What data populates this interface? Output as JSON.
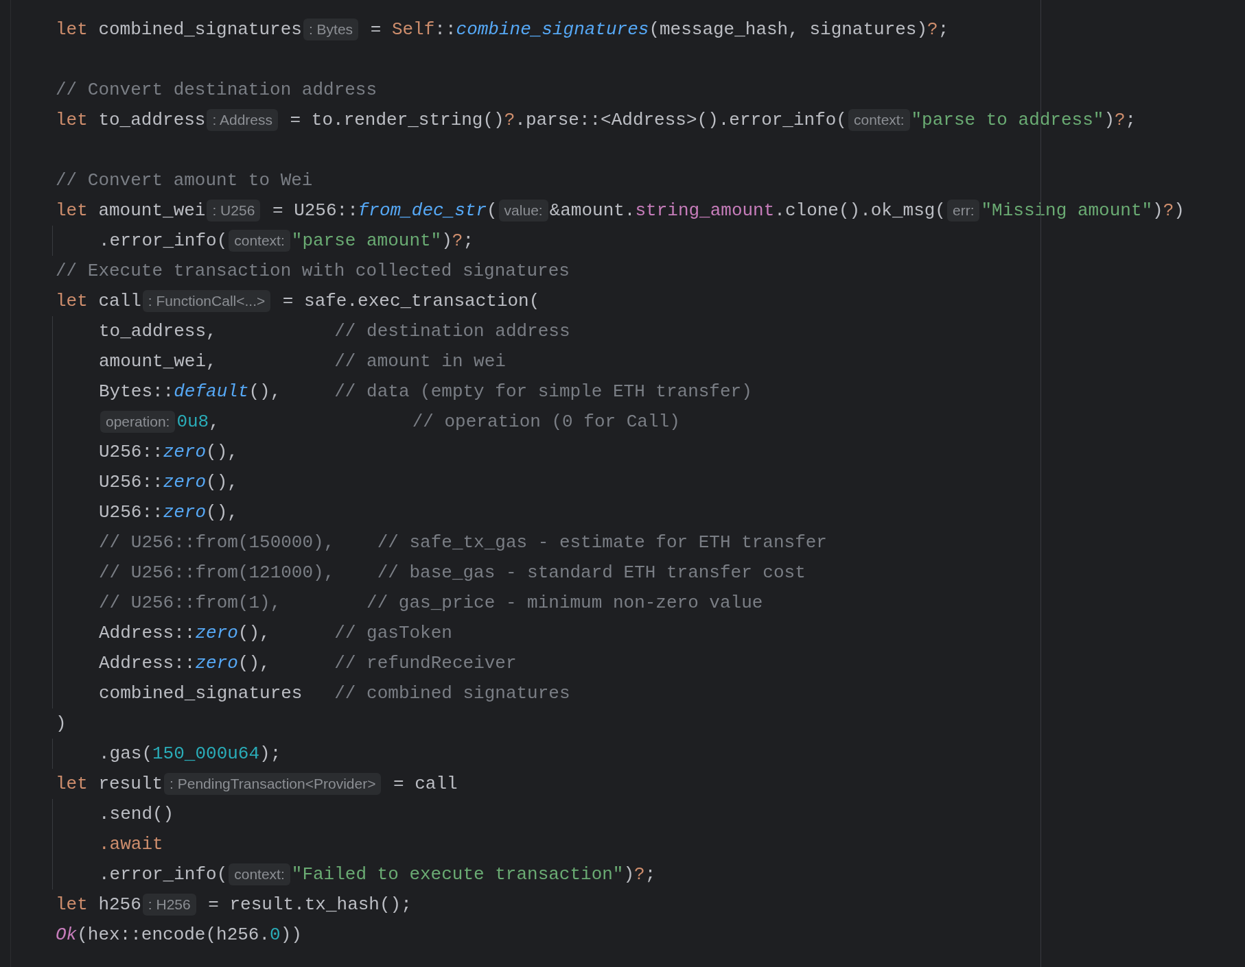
{
  "editor": {
    "lines": [
      {
        "kind": "code",
        "indented": false,
        "tokens": [
          {
            "kind": "kw",
            "s": "let"
          },
          {
            "kind": "t",
            "s": " combined_signatures"
          },
          {
            "kind": "hint",
            "s": ": Bytes"
          },
          {
            "kind": "t",
            "s": " = "
          },
          {
            "kind": "kw",
            "s": "Self"
          },
          {
            "kind": "t",
            "s": "::"
          },
          {
            "kind": "fn",
            "s": "combine_signatures"
          },
          {
            "kind": "t",
            "s": "(message_hash, signatures)"
          },
          {
            "kind": "op",
            "s": "?"
          },
          {
            "kind": "t",
            "s": ";"
          }
        ]
      },
      {
        "kind": "blank"
      },
      {
        "kind": "code",
        "indented": false,
        "tokens": [
          {
            "kind": "cm",
            "s": "// Convert destination address"
          }
        ]
      },
      {
        "kind": "code",
        "indented": false,
        "tokens": [
          {
            "kind": "kw",
            "s": "let"
          },
          {
            "kind": "t",
            "s": " to_address"
          },
          {
            "kind": "hint",
            "s": ": Address"
          },
          {
            "kind": "t",
            "s": " = to.render_string()"
          },
          {
            "kind": "op",
            "s": "?"
          },
          {
            "kind": "t",
            "s": ".parse::<Address>().error_info("
          },
          {
            "kind": "hint",
            "s": "context:"
          },
          {
            "kind": "str",
            "s": "\"parse to address\""
          },
          {
            "kind": "t",
            "s": ")"
          },
          {
            "kind": "op",
            "s": "?"
          },
          {
            "kind": "t",
            "s": ";"
          }
        ]
      },
      {
        "kind": "blank"
      },
      {
        "kind": "code",
        "indented": false,
        "tokens": [
          {
            "kind": "cm",
            "s": "// Convert amount to Wei"
          }
        ]
      },
      {
        "kind": "code",
        "indented": false,
        "tokens": [
          {
            "kind": "kw",
            "s": "let"
          },
          {
            "kind": "t",
            "s": " amount_wei"
          },
          {
            "kind": "hint",
            "s": ": U256"
          },
          {
            "kind": "t",
            "s": " = U256::"
          },
          {
            "kind": "fn",
            "s": "from_dec_str"
          },
          {
            "kind": "t",
            "s": "("
          },
          {
            "kind": "hint",
            "s": "value:"
          },
          {
            "kind": "t",
            "s": "&amount."
          },
          {
            "kind": "fld",
            "s": "string_amount"
          },
          {
            "kind": "t",
            "s": ".clone().ok_msg("
          },
          {
            "kind": "hint",
            "s": "err:"
          },
          {
            "kind": "str",
            "s": "\"Missing amount\""
          },
          {
            "kind": "t",
            "s": ")"
          },
          {
            "kind": "op",
            "s": "?"
          },
          {
            "kind": "t",
            "s": ")"
          }
        ]
      },
      {
        "kind": "code",
        "indented": true,
        "tokens": [
          {
            "kind": "t",
            "s": ".error_info("
          },
          {
            "kind": "hint",
            "s": "context:"
          },
          {
            "kind": "str",
            "s": "\"parse amount\""
          },
          {
            "kind": "t",
            "s": ")"
          },
          {
            "kind": "op",
            "s": "?"
          },
          {
            "kind": "t",
            "s": ";"
          }
        ]
      },
      {
        "kind": "code",
        "indented": false,
        "tokens": [
          {
            "kind": "cm",
            "s": "// Execute transaction with collected signatures"
          }
        ]
      },
      {
        "kind": "code",
        "indented": false,
        "tokens": [
          {
            "kind": "kw",
            "s": "let"
          },
          {
            "kind": "t",
            "s": " call"
          },
          {
            "kind": "hint",
            "s": ": FunctionCall<...>"
          },
          {
            "kind": "t",
            "s": " = safe.exec_transaction("
          }
        ]
      },
      {
        "kind": "code",
        "indented": true,
        "tokens": [
          {
            "kind": "t",
            "s": "to_address,           "
          },
          {
            "kind": "cm",
            "s": "// destination address"
          }
        ]
      },
      {
        "kind": "code",
        "indented": true,
        "tokens": [
          {
            "kind": "t",
            "s": "amount_wei,           "
          },
          {
            "kind": "cm",
            "s": "// amount in wei"
          }
        ]
      },
      {
        "kind": "code",
        "indented": true,
        "tokens": [
          {
            "kind": "t",
            "s": "Bytes::"
          },
          {
            "kind": "fn",
            "s": "default"
          },
          {
            "kind": "t",
            "s": "(),     "
          },
          {
            "kind": "cm",
            "s": "// data (empty for simple ETH transfer)"
          }
        ]
      },
      {
        "kind": "code",
        "indented": true,
        "tokens": [
          {
            "kind": "hint",
            "s": "operation:"
          },
          {
            "kind": "num",
            "s": "0u8"
          },
          {
            "kind": "t",
            "s": ",                  "
          },
          {
            "kind": "cm",
            "s": "// operation (0 for Call)"
          }
        ]
      },
      {
        "kind": "code",
        "indented": true,
        "tokens": [
          {
            "kind": "t",
            "s": "U256::"
          },
          {
            "kind": "fn",
            "s": "zero"
          },
          {
            "kind": "t",
            "s": "(),"
          }
        ]
      },
      {
        "kind": "code",
        "indented": true,
        "tokens": [
          {
            "kind": "t",
            "s": "U256::"
          },
          {
            "kind": "fn",
            "s": "zero"
          },
          {
            "kind": "t",
            "s": "(),"
          }
        ]
      },
      {
        "kind": "code",
        "indented": true,
        "tokens": [
          {
            "kind": "t",
            "s": "U256::"
          },
          {
            "kind": "fn",
            "s": "zero"
          },
          {
            "kind": "t",
            "s": "(),"
          }
        ]
      },
      {
        "kind": "code",
        "indented": true,
        "tokens": [
          {
            "kind": "cm",
            "s": "// U256::from(150000),    // safe_tx_gas - estimate for ETH transfer"
          }
        ]
      },
      {
        "kind": "code",
        "indented": true,
        "tokens": [
          {
            "kind": "cm",
            "s": "// U256::from(121000),    // base_gas - standard ETH transfer cost"
          }
        ]
      },
      {
        "kind": "code",
        "indented": true,
        "tokens": [
          {
            "kind": "cm",
            "s": "// U256::from(1),        // gas_price - minimum non-zero value"
          }
        ]
      },
      {
        "kind": "code",
        "indented": true,
        "tokens": [
          {
            "kind": "t",
            "s": "Address::"
          },
          {
            "kind": "fn",
            "s": "zero"
          },
          {
            "kind": "t",
            "s": "(),      "
          },
          {
            "kind": "cm",
            "s": "// gasToken"
          }
        ]
      },
      {
        "kind": "code",
        "indented": true,
        "tokens": [
          {
            "kind": "t",
            "s": "Address::"
          },
          {
            "kind": "fn",
            "s": "zero"
          },
          {
            "kind": "t",
            "s": "(),      "
          },
          {
            "kind": "cm",
            "s": "// refundReceiver"
          }
        ]
      },
      {
        "kind": "code",
        "indented": true,
        "tokens": [
          {
            "kind": "t",
            "s": "combined_signatures   "
          },
          {
            "kind": "cm",
            "s": "// combined signatures"
          }
        ]
      },
      {
        "kind": "code",
        "indented": false,
        "tokens": [
          {
            "kind": "t",
            "s": ")"
          }
        ]
      },
      {
        "kind": "code",
        "indented": true,
        "tokens": [
          {
            "kind": "t",
            "s": ".gas("
          },
          {
            "kind": "num",
            "s": "150_000u64"
          },
          {
            "kind": "t",
            "s": ");"
          }
        ]
      },
      {
        "kind": "code",
        "indented": false,
        "tokens": [
          {
            "kind": "kw",
            "s": "let"
          },
          {
            "kind": "t",
            "s": " result"
          },
          {
            "kind": "hint",
            "s": ": PendingTransaction<Provider>"
          },
          {
            "kind": "t",
            "s": " = call"
          }
        ]
      },
      {
        "kind": "code",
        "indented": true,
        "tokens": [
          {
            "kind": "t",
            "s": ".send()"
          }
        ]
      },
      {
        "kind": "code",
        "indented": true,
        "tokens": [
          {
            "kind": "kw",
            "s": ".await"
          }
        ]
      },
      {
        "kind": "code",
        "indented": true,
        "tokens": [
          {
            "kind": "t",
            "s": ".error_info("
          },
          {
            "kind": "hint",
            "s": "context:"
          },
          {
            "kind": "str",
            "s": "\"Failed to execute transaction\""
          },
          {
            "kind": "t",
            "s": ")"
          },
          {
            "kind": "op",
            "s": "?"
          },
          {
            "kind": "t",
            "s": ";"
          }
        ]
      },
      {
        "kind": "code",
        "indented": false,
        "tokens": [
          {
            "kind": "kw",
            "s": "let"
          },
          {
            "kind": "t",
            "s": " h256"
          },
          {
            "kind": "hint",
            "s": ": H256"
          },
          {
            "kind": "t",
            "s": " = result.tx_hash();"
          }
        ]
      },
      {
        "kind": "code",
        "indented": false,
        "tokens": [
          {
            "kind": "ok",
            "s": "Ok"
          },
          {
            "kind": "t",
            "s": "(hex::encode(h256."
          },
          {
            "kind": "num",
            "s": "0"
          },
          {
            "kind": "t",
            "s": "))"
          }
        ]
      }
    ]
  }
}
